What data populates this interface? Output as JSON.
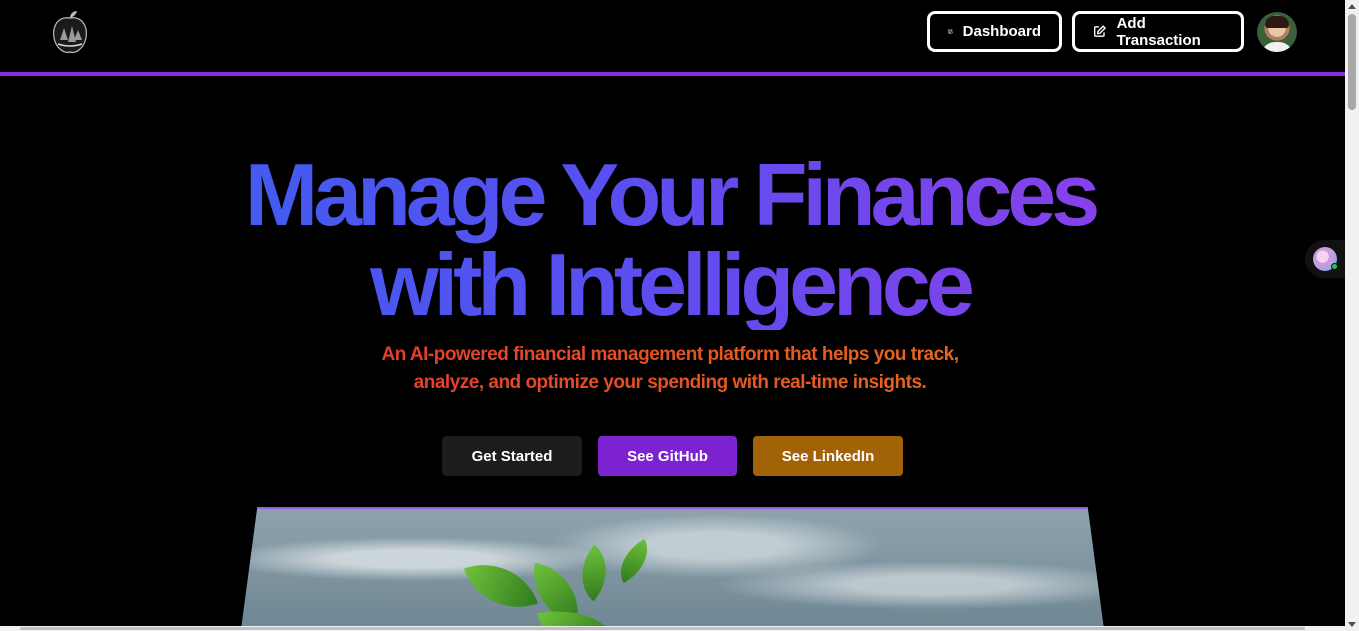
{
  "header": {
    "dashboard_label": "Dashboard",
    "add_transaction_label": "Add Transaction",
    "accent_color": "#8a2be2"
  },
  "hero": {
    "title_line1": "Manage Your Finances",
    "title_line2": "with Intelligence",
    "subtitle_line1": "An AI-powered financial management platform that helps you track,",
    "subtitle_line2": "analyze, and optimize your spending with real-time insights.",
    "buttons": {
      "get_started": "Get Started",
      "github": "See GitHub",
      "linkedin": "See LinkedIn"
    }
  },
  "icons": {
    "logo": "apple-tree-logo-icon",
    "dashboard": "layout-grid-icon",
    "add_transaction": "pen-square-icon",
    "avatar": "user-avatar",
    "widget": "chat-assistant-icon"
  }
}
